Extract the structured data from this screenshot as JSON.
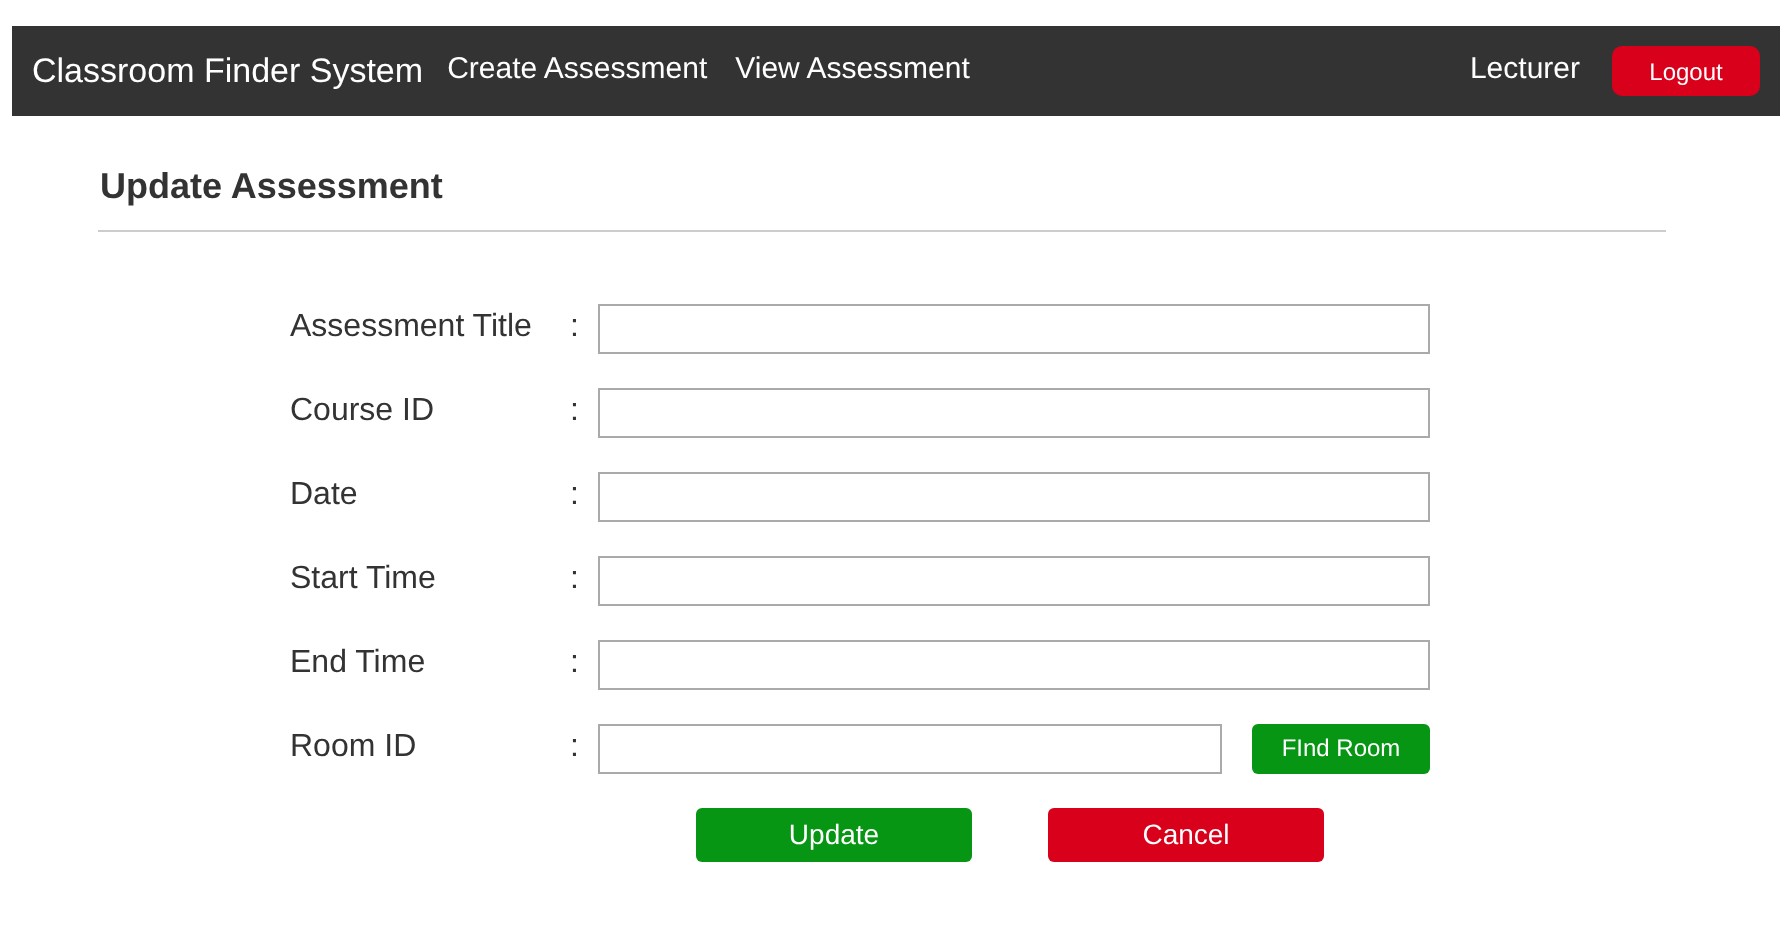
{
  "navbar": {
    "brand": "Classroom Finder System",
    "links": [
      "Create Assessment",
      "View Assessment"
    ],
    "user": "Lecturer",
    "logout": "Logout"
  },
  "page": {
    "title": "Update Assessment"
  },
  "form": {
    "fields": [
      {
        "label": "Assessment Title",
        "separator": ":"
      },
      {
        "label": "Course ID",
        "separator": ":"
      },
      {
        "label": "Date",
        "separator": ":"
      },
      {
        "label": "Start Time",
        "separator": ":"
      },
      {
        "label": "End Time",
        "separator": ":"
      },
      {
        "label": "Room ID",
        "separator": ":",
        "action": "FInd Room"
      }
    ],
    "buttons": [
      {
        "label": "Update",
        "kind": "primary"
      },
      {
        "label": "Cancel",
        "kind": "danger"
      }
    ]
  }
}
